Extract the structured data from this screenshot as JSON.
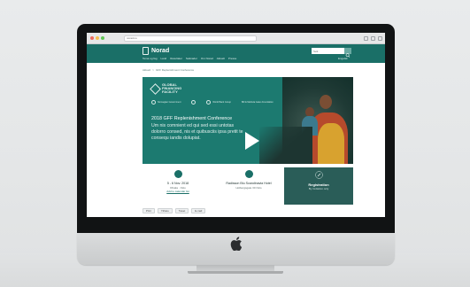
{
  "browser": {
    "url": "norad.no",
    "traffic_lights": [
      "#ec6a5e",
      "#f4bf4f",
      "#61c554"
    ]
  },
  "header": {
    "logo_text": "Norad",
    "search_placeholder": "Søk",
    "nav_items": [
      "Tema og fag",
      "Land",
      "Resultater",
      "Søknader",
      "Om Norad",
      "Aktuelt",
      "Presse"
    ],
    "language": "Engelsk"
  },
  "breadcrumb": [
    "Aktuelt",
    ">",
    "GFF Replenishment Conference"
  ],
  "hero": {
    "fund_name": "GLOBAL FINANCING FACILITY",
    "partners": [
      "Norwegian Government",
      "Burkina Faso",
      "World Bank Group",
      "Bill & Melinda Gates Foundation"
    ],
    "title": "2018 GFF Replenishment Conference",
    "body": "Um nis comnient ed qui sed essi untotas dolorro consed, nis et quibusciis ipsa pretit te consequ iandis dolupiat.",
    "play_label": "Play video",
    "accent": "#1c7a70"
  },
  "info": {
    "date": "5 - 6 Nov. 2018",
    "date_sub": "Dhaka · Oslo",
    "calendar_link": "Add to calendar list",
    "venue": "Radisson Blu Scandinavia Hotel",
    "venue_sub": "Holbergsgate 30\nOslo",
    "registration": "Registration",
    "registration_sub": "By invitation only"
  },
  "share": [
    "Print",
    "f Share",
    "Tweet",
    "E-mail"
  ],
  "colors": {
    "brand": "#1a6f67",
    "registration_bg": "#2a5d58"
  }
}
